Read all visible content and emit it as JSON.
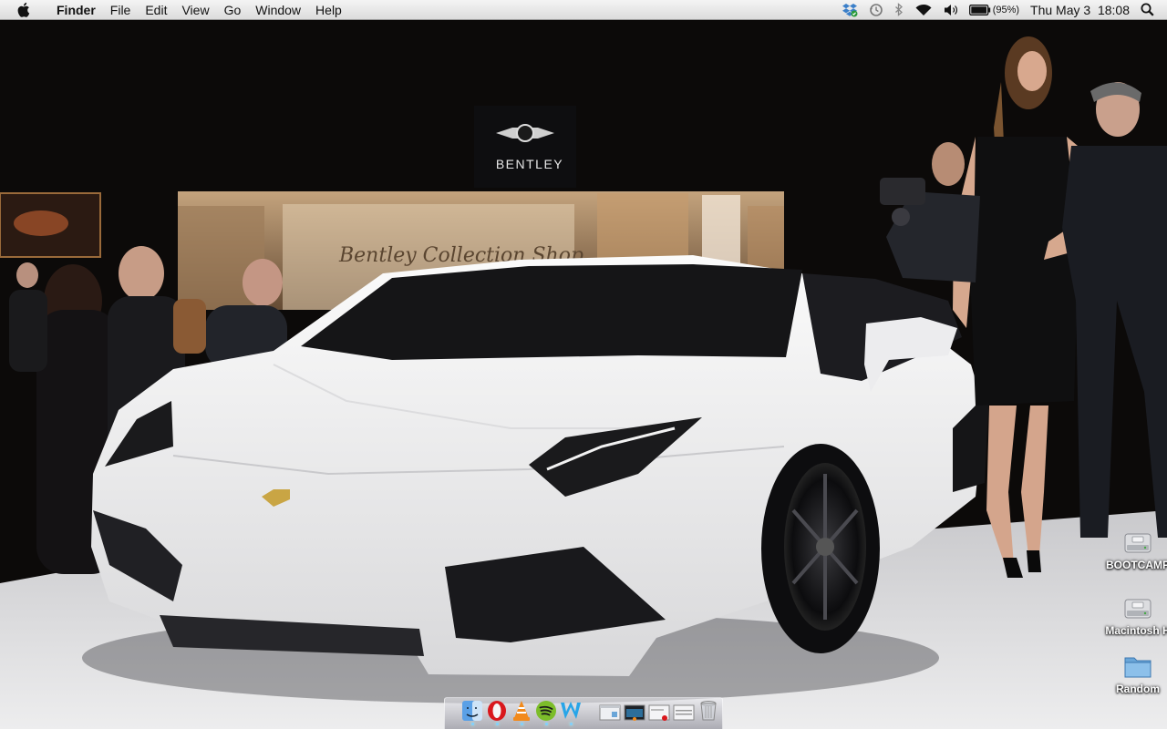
{
  "menubar": {
    "apple_icon": "apple-logo-icon",
    "app_name": "Finder",
    "menus": [
      "File",
      "Edit",
      "View",
      "Go",
      "Window",
      "Help"
    ],
    "status": {
      "battery_percent": "(95%)",
      "datetime": "Thu May 3  18:08"
    }
  },
  "desktop": {
    "icons": [
      {
        "label": "BOOTCAMP",
        "icon": "hard-drive-icon"
      },
      {
        "label": "Macintosh H",
        "icon": "hard-drive-icon"
      },
      {
        "label": "Random",
        "icon": "folder-icon"
      }
    ]
  },
  "wallpaper": {
    "showroom_brand": "BENTLEY",
    "shop_sign": "Bentley Collection Shop"
  },
  "dock": {
    "apps": [
      "Finder",
      "Opera",
      "VLC",
      "Spotify",
      "W"
    ],
    "windows": [
      "window-thumb-1",
      "window-thumb-2",
      "window-thumb-3",
      "window-thumb-4"
    ],
    "trash": "Trash"
  },
  "colors": {
    "menubar_bg": "#e6e6e6",
    "car_white": "#f2f2f2",
    "showroom_dark": "#0c0a09",
    "dock_indicator": "#7fd0ff"
  }
}
